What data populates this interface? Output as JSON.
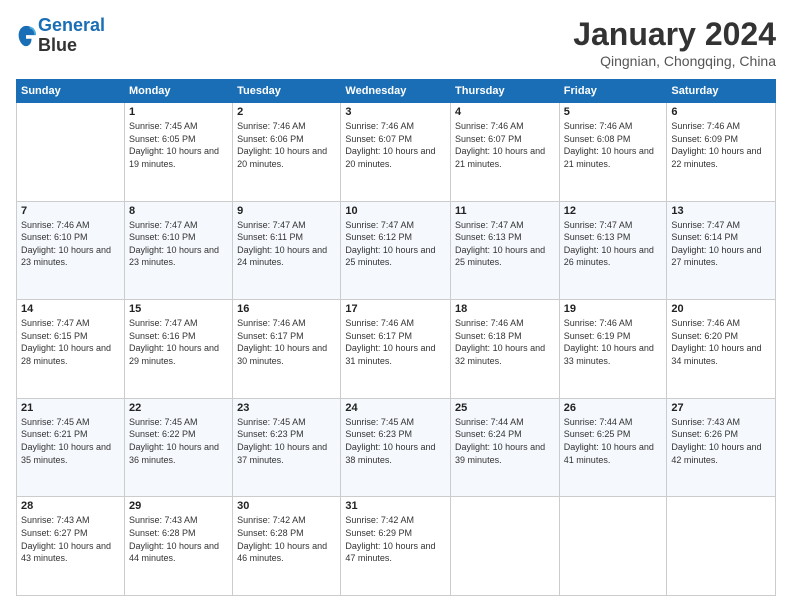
{
  "logo": {
    "line1": "General",
    "line2": "Blue"
  },
  "title": "January 2024",
  "location": "Qingnian, Chongqing, China",
  "weekdays": [
    "Sunday",
    "Monday",
    "Tuesday",
    "Wednesday",
    "Thursday",
    "Friday",
    "Saturday"
  ],
  "weeks": [
    [
      {
        "day": "",
        "sunrise": "",
        "sunset": "",
        "daylight": ""
      },
      {
        "day": "1",
        "sunrise": "Sunrise: 7:45 AM",
        "sunset": "Sunset: 6:05 PM",
        "daylight": "Daylight: 10 hours and 19 minutes."
      },
      {
        "day": "2",
        "sunrise": "Sunrise: 7:46 AM",
        "sunset": "Sunset: 6:06 PM",
        "daylight": "Daylight: 10 hours and 20 minutes."
      },
      {
        "day": "3",
        "sunrise": "Sunrise: 7:46 AM",
        "sunset": "Sunset: 6:07 PM",
        "daylight": "Daylight: 10 hours and 20 minutes."
      },
      {
        "day": "4",
        "sunrise": "Sunrise: 7:46 AM",
        "sunset": "Sunset: 6:07 PM",
        "daylight": "Daylight: 10 hours and 21 minutes."
      },
      {
        "day": "5",
        "sunrise": "Sunrise: 7:46 AM",
        "sunset": "Sunset: 6:08 PM",
        "daylight": "Daylight: 10 hours and 21 minutes."
      },
      {
        "day": "6",
        "sunrise": "Sunrise: 7:46 AM",
        "sunset": "Sunset: 6:09 PM",
        "daylight": "Daylight: 10 hours and 22 minutes."
      }
    ],
    [
      {
        "day": "7",
        "sunrise": "Sunrise: 7:46 AM",
        "sunset": "Sunset: 6:10 PM",
        "daylight": "Daylight: 10 hours and 23 minutes."
      },
      {
        "day": "8",
        "sunrise": "Sunrise: 7:47 AM",
        "sunset": "Sunset: 6:10 PM",
        "daylight": "Daylight: 10 hours and 23 minutes."
      },
      {
        "day": "9",
        "sunrise": "Sunrise: 7:47 AM",
        "sunset": "Sunset: 6:11 PM",
        "daylight": "Daylight: 10 hours and 24 minutes."
      },
      {
        "day": "10",
        "sunrise": "Sunrise: 7:47 AM",
        "sunset": "Sunset: 6:12 PM",
        "daylight": "Daylight: 10 hours and 25 minutes."
      },
      {
        "day": "11",
        "sunrise": "Sunrise: 7:47 AM",
        "sunset": "Sunset: 6:13 PM",
        "daylight": "Daylight: 10 hours and 25 minutes."
      },
      {
        "day": "12",
        "sunrise": "Sunrise: 7:47 AM",
        "sunset": "Sunset: 6:13 PM",
        "daylight": "Daylight: 10 hours and 26 minutes."
      },
      {
        "day": "13",
        "sunrise": "Sunrise: 7:47 AM",
        "sunset": "Sunset: 6:14 PM",
        "daylight": "Daylight: 10 hours and 27 minutes."
      }
    ],
    [
      {
        "day": "14",
        "sunrise": "Sunrise: 7:47 AM",
        "sunset": "Sunset: 6:15 PM",
        "daylight": "Daylight: 10 hours and 28 minutes."
      },
      {
        "day": "15",
        "sunrise": "Sunrise: 7:47 AM",
        "sunset": "Sunset: 6:16 PM",
        "daylight": "Daylight: 10 hours and 29 minutes."
      },
      {
        "day": "16",
        "sunrise": "Sunrise: 7:46 AM",
        "sunset": "Sunset: 6:17 PM",
        "daylight": "Daylight: 10 hours and 30 minutes."
      },
      {
        "day": "17",
        "sunrise": "Sunrise: 7:46 AM",
        "sunset": "Sunset: 6:17 PM",
        "daylight": "Daylight: 10 hours and 31 minutes."
      },
      {
        "day": "18",
        "sunrise": "Sunrise: 7:46 AM",
        "sunset": "Sunset: 6:18 PM",
        "daylight": "Daylight: 10 hours and 32 minutes."
      },
      {
        "day": "19",
        "sunrise": "Sunrise: 7:46 AM",
        "sunset": "Sunset: 6:19 PM",
        "daylight": "Daylight: 10 hours and 33 minutes."
      },
      {
        "day": "20",
        "sunrise": "Sunrise: 7:46 AM",
        "sunset": "Sunset: 6:20 PM",
        "daylight": "Daylight: 10 hours and 34 minutes."
      }
    ],
    [
      {
        "day": "21",
        "sunrise": "Sunrise: 7:45 AM",
        "sunset": "Sunset: 6:21 PM",
        "daylight": "Daylight: 10 hours and 35 minutes."
      },
      {
        "day": "22",
        "sunrise": "Sunrise: 7:45 AM",
        "sunset": "Sunset: 6:22 PM",
        "daylight": "Daylight: 10 hours and 36 minutes."
      },
      {
        "day": "23",
        "sunrise": "Sunrise: 7:45 AM",
        "sunset": "Sunset: 6:23 PM",
        "daylight": "Daylight: 10 hours and 37 minutes."
      },
      {
        "day": "24",
        "sunrise": "Sunrise: 7:45 AM",
        "sunset": "Sunset: 6:23 PM",
        "daylight": "Daylight: 10 hours and 38 minutes."
      },
      {
        "day": "25",
        "sunrise": "Sunrise: 7:44 AM",
        "sunset": "Sunset: 6:24 PM",
        "daylight": "Daylight: 10 hours and 39 minutes."
      },
      {
        "day": "26",
        "sunrise": "Sunrise: 7:44 AM",
        "sunset": "Sunset: 6:25 PM",
        "daylight": "Daylight: 10 hours and 41 minutes."
      },
      {
        "day": "27",
        "sunrise": "Sunrise: 7:43 AM",
        "sunset": "Sunset: 6:26 PM",
        "daylight": "Daylight: 10 hours and 42 minutes."
      }
    ],
    [
      {
        "day": "28",
        "sunrise": "Sunrise: 7:43 AM",
        "sunset": "Sunset: 6:27 PM",
        "daylight": "Daylight: 10 hours and 43 minutes."
      },
      {
        "day": "29",
        "sunrise": "Sunrise: 7:43 AM",
        "sunset": "Sunset: 6:28 PM",
        "daylight": "Daylight: 10 hours and 44 minutes."
      },
      {
        "day": "30",
        "sunrise": "Sunrise: 7:42 AM",
        "sunset": "Sunset: 6:28 PM",
        "daylight": "Daylight: 10 hours and 46 minutes."
      },
      {
        "day": "31",
        "sunrise": "Sunrise: 7:42 AM",
        "sunset": "Sunset: 6:29 PM",
        "daylight": "Daylight: 10 hours and 47 minutes."
      },
      {
        "day": "",
        "sunrise": "",
        "sunset": "",
        "daylight": ""
      },
      {
        "day": "",
        "sunrise": "",
        "sunset": "",
        "daylight": ""
      },
      {
        "day": "",
        "sunrise": "",
        "sunset": "",
        "daylight": ""
      }
    ]
  ]
}
